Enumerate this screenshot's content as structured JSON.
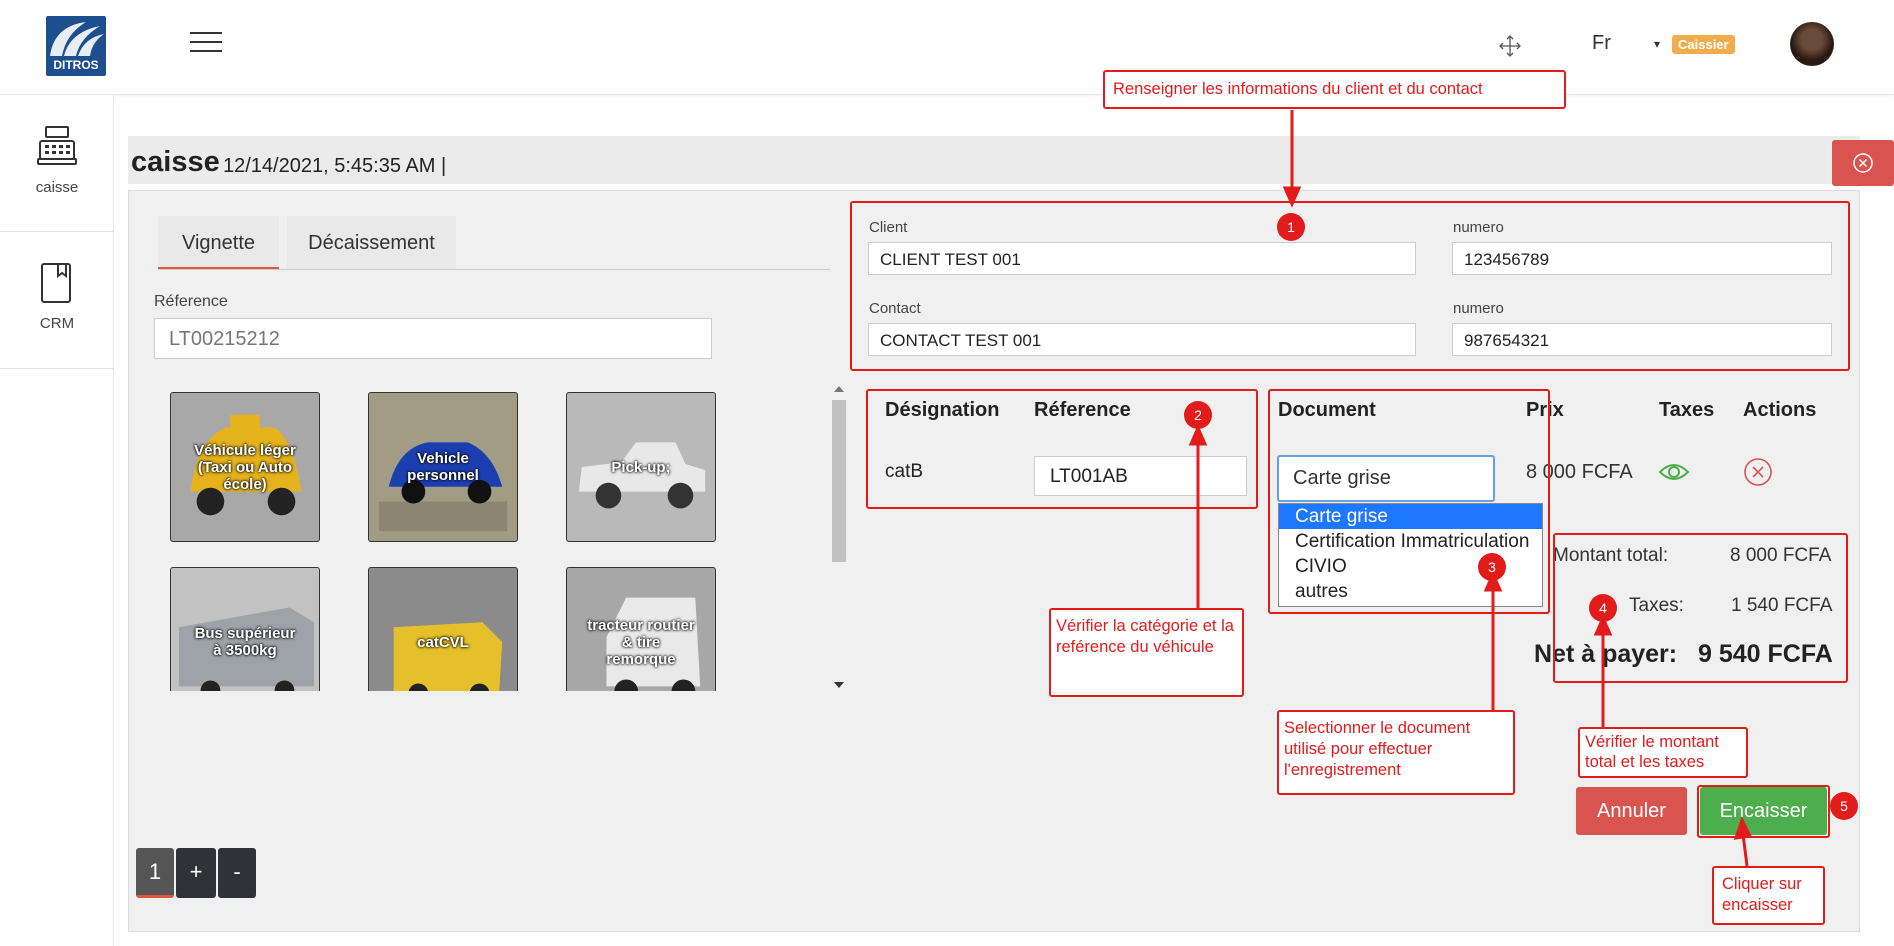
{
  "header": {
    "logo_text": "DITROS",
    "language": "Fr",
    "role_caret": "▾",
    "role_badge": "Caissier",
    "icons": [
      "menu-icon",
      "move-icon",
      "avatar"
    ]
  },
  "sidebar": {
    "items": [
      {
        "label": "caisse",
        "icon": "cash-register-icon"
      },
      {
        "label": "CRM",
        "icon": "book-icon"
      }
    ]
  },
  "page": {
    "title": "caisse",
    "datetime": "12/14/2021, 5:45:35 AM  |"
  },
  "tabs": [
    {
      "label": "Vignette",
      "active": true
    },
    {
      "label": "Décaissement",
      "active": false
    }
  ],
  "reference": {
    "label": "Réference",
    "value": "LT00215212"
  },
  "vehicles": [
    {
      "label": "Véhicule léger (Taxi ou Auto école)"
    },
    {
      "label": "Vehicle personnel"
    },
    {
      "label": "Pick-up;"
    },
    {
      "label": "Bus supérieur à 3500kg"
    },
    {
      "label": "catCVL"
    },
    {
      "label": "tracteur routier & tire remorque"
    }
  ],
  "pager": {
    "page": "1",
    "plus": "+",
    "minus": "-"
  },
  "client_form": {
    "client_label": "Client",
    "client_value": "CLIENT TEST 001",
    "client_num_label": "numero",
    "client_num_value": "123456789",
    "contact_label": "Contact",
    "contact_value": "CONTACT TEST 001",
    "contact_num_label": "numero",
    "contact_num_value": "987654321"
  },
  "table": {
    "headers": {
      "designation": "Désignation",
      "reference": "Réference",
      "document": "Document",
      "prix": "Prix",
      "taxes": "Taxes",
      "actions": "Actions"
    },
    "row": {
      "designation": "catB",
      "reference": "LT001AB",
      "document": "Carte grise",
      "prix": "8 000 FCFA"
    },
    "document_options": [
      "Carte grise",
      "Certification Immatriculation",
      "CIVIO",
      "autres"
    ]
  },
  "totals": {
    "montant_label": "Montant total:",
    "montant_value": "8 000 FCFA",
    "taxes_label": "Taxes:",
    "taxes_value": "1 540 FCFA",
    "net_label": "Net à payer:",
    "net_value": "9 540 FCFA"
  },
  "buttons": {
    "annuler": "Annuler",
    "encaisser": "Encaisser"
  },
  "annotations": {
    "note1": "Renseigner les informations du client et du contact",
    "note2": "Vérifier la catégorie et la reférence du véhicule",
    "note3": "Selectionner le document utilisé pour effectuer l'enregistrement",
    "note4": "Vérifier le montant total et les taxes",
    "note5": "Cliquer sur encaisser",
    "steps": [
      "1",
      "2",
      "3",
      "4",
      "5"
    ]
  },
  "colors": {
    "accent_red": "#e21b1b",
    "danger": "#d9534f",
    "success": "#4cae4c",
    "badge": "#f0ad4e",
    "tab_underline": "#e0573a"
  }
}
